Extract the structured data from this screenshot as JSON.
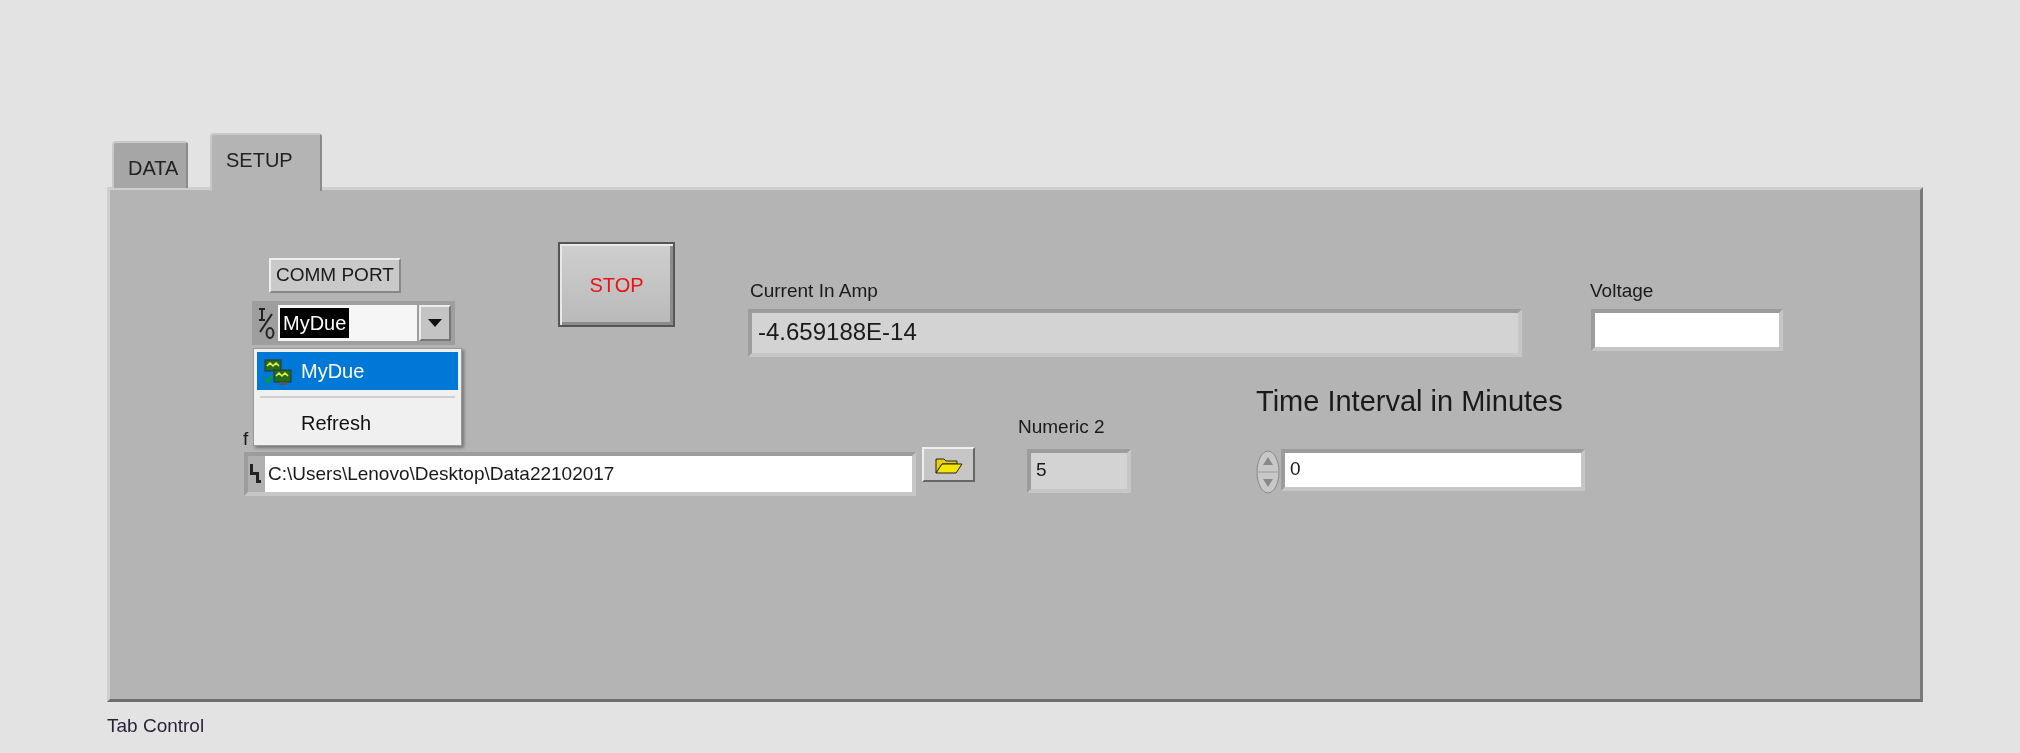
{
  "tabs": [
    {
      "label": "DATA",
      "selected": false
    },
    {
      "label": "SETUP",
      "selected": true
    }
  ],
  "comm_port": {
    "label": "COMM PORT",
    "value": "MyDue",
    "menu": {
      "items": [
        {
          "label": "MyDue",
          "kind": "device",
          "selected": true
        },
        {
          "label": "Refresh",
          "kind": "action",
          "selected": false
        }
      ]
    }
  },
  "stop_button": {
    "label": "STOP"
  },
  "current": {
    "label": "Current In Amp",
    "value": "-4.659188E-14"
  },
  "voltage": {
    "label": "Voltage"
  },
  "file_path": {
    "label": "f",
    "value": "C:\\Users\\Lenovo\\Desktop\\Data22102017"
  },
  "numeric_2": {
    "label": "Numeric 2",
    "value": "5"
  },
  "time_interval": {
    "label": "Time Interval in Minutes",
    "value": "0"
  },
  "tab_control_label": "Tab Control"
}
